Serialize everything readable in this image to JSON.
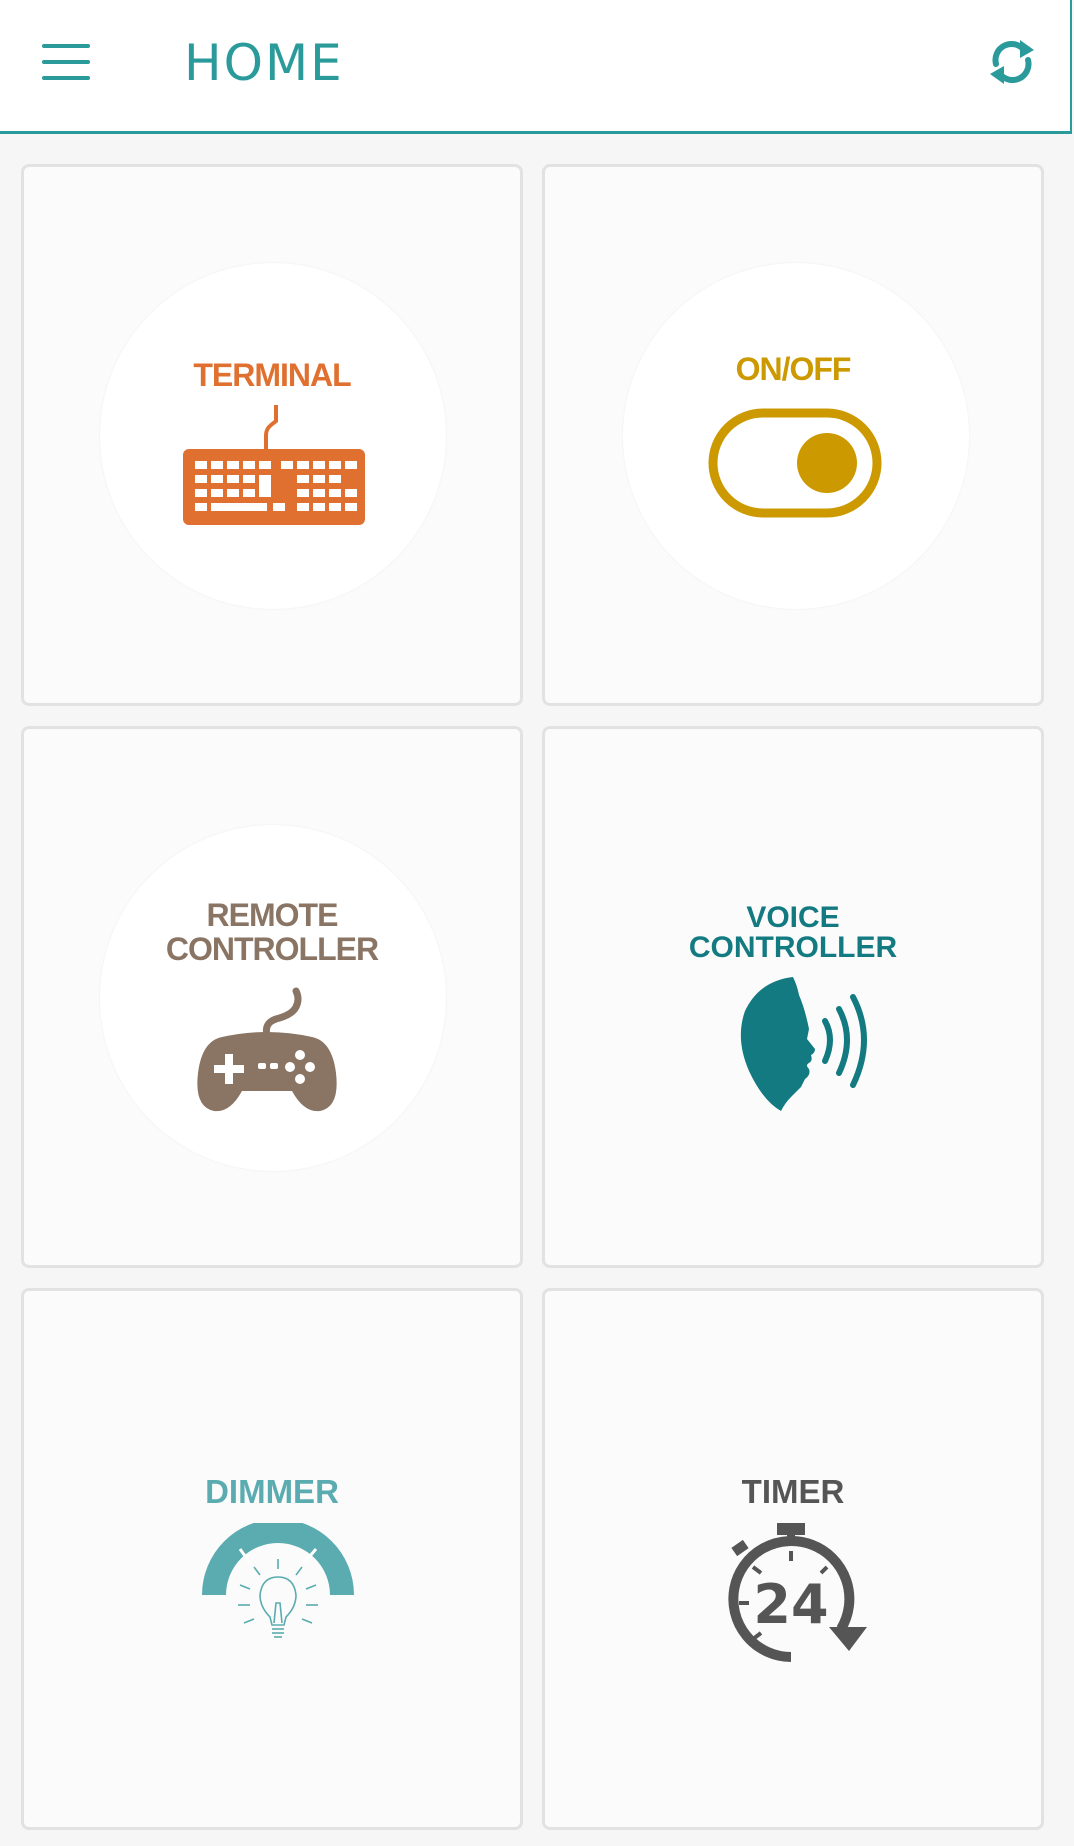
{
  "header": {
    "title": "HOME",
    "menu_icon": "hamburger-menu-icon",
    "refresh_icon": "refresh-icon",
    "accent": "#2a9a9a"
  },
  "tiles": [
    {
      "label": "TERMINAL",
      "icon": "keyboard-icon",
      "color": "#e07030"
    },
    {
      "label": "ON/OFF",
      "icon": "toggle-switch-icon",
      "color": "#cc9900"
    },
    {
      "label_lines": [
        "REMOTE",
        "CONTROLLER"
      ],
      "icon": "gamepad-icon",
      "color": "#8a7565"
    },
    {
      "label_lines": [
        "VOICE",
        "CONTROLLER"
      ],
      "icon": "speaking-head-icon",
      "color": "#127a80"
    },
    {
      "label": "DIMMER",
      "icon": "dimmer-bulb-icon",
      "color": "#5aacb0"
    },
    {
      "label": "TIMER",
      "icon": "stopwatch-24-icon",
      "color": "#555555",
      "icon_text": "24"
    }
  ]
}
